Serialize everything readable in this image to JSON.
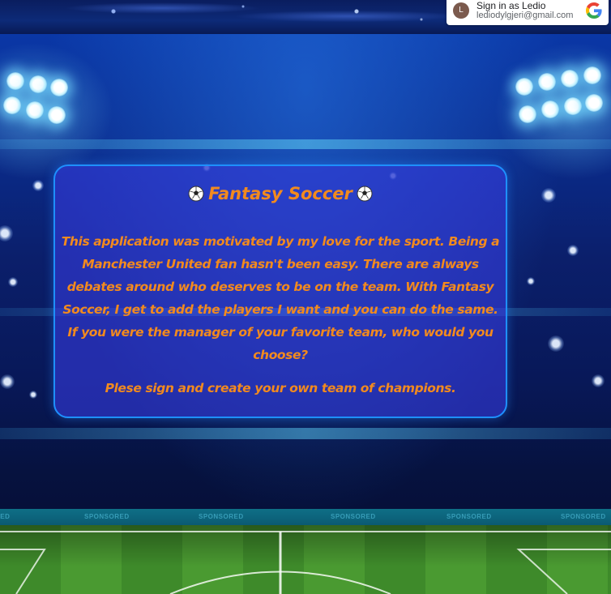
{
  "google_signin": {
    "avatar_initial": "L",
    "label": "Sign in as Ledio",
    "email": "lediodylgjeri@gmail.com",
    "logo_icon": "google-g-icon"
  },
  "intro": {
    "title": "Fantasy Soccer",
    "title_icon": "soccer-ball-icon",
    "body": "This application was motivated by my love for the sport. Being a Manchester United fan hasn't been easy. There are always debates around who deserves to be on the team. With Fantasy Soccer, I get to add the players I want and you can do the same. If you were the manager of your favorite team, who would you choose?",
    "cta": "Plese sign and create your own team of champions."
  },
  "background": {
    "sponsor_labels": [
      "RED",
      "SPONSORED",
      "SPONSORED",
      "SPONSORED",
      "SPONSORED",
      "SPONSORED"
    ]
  },
  "colors": {
    "accent_text": "#f28a1e",
    "card_border": "#1e90ff",
    "card_fill": "rgba(52,58,220,0.62)"
  }
}
